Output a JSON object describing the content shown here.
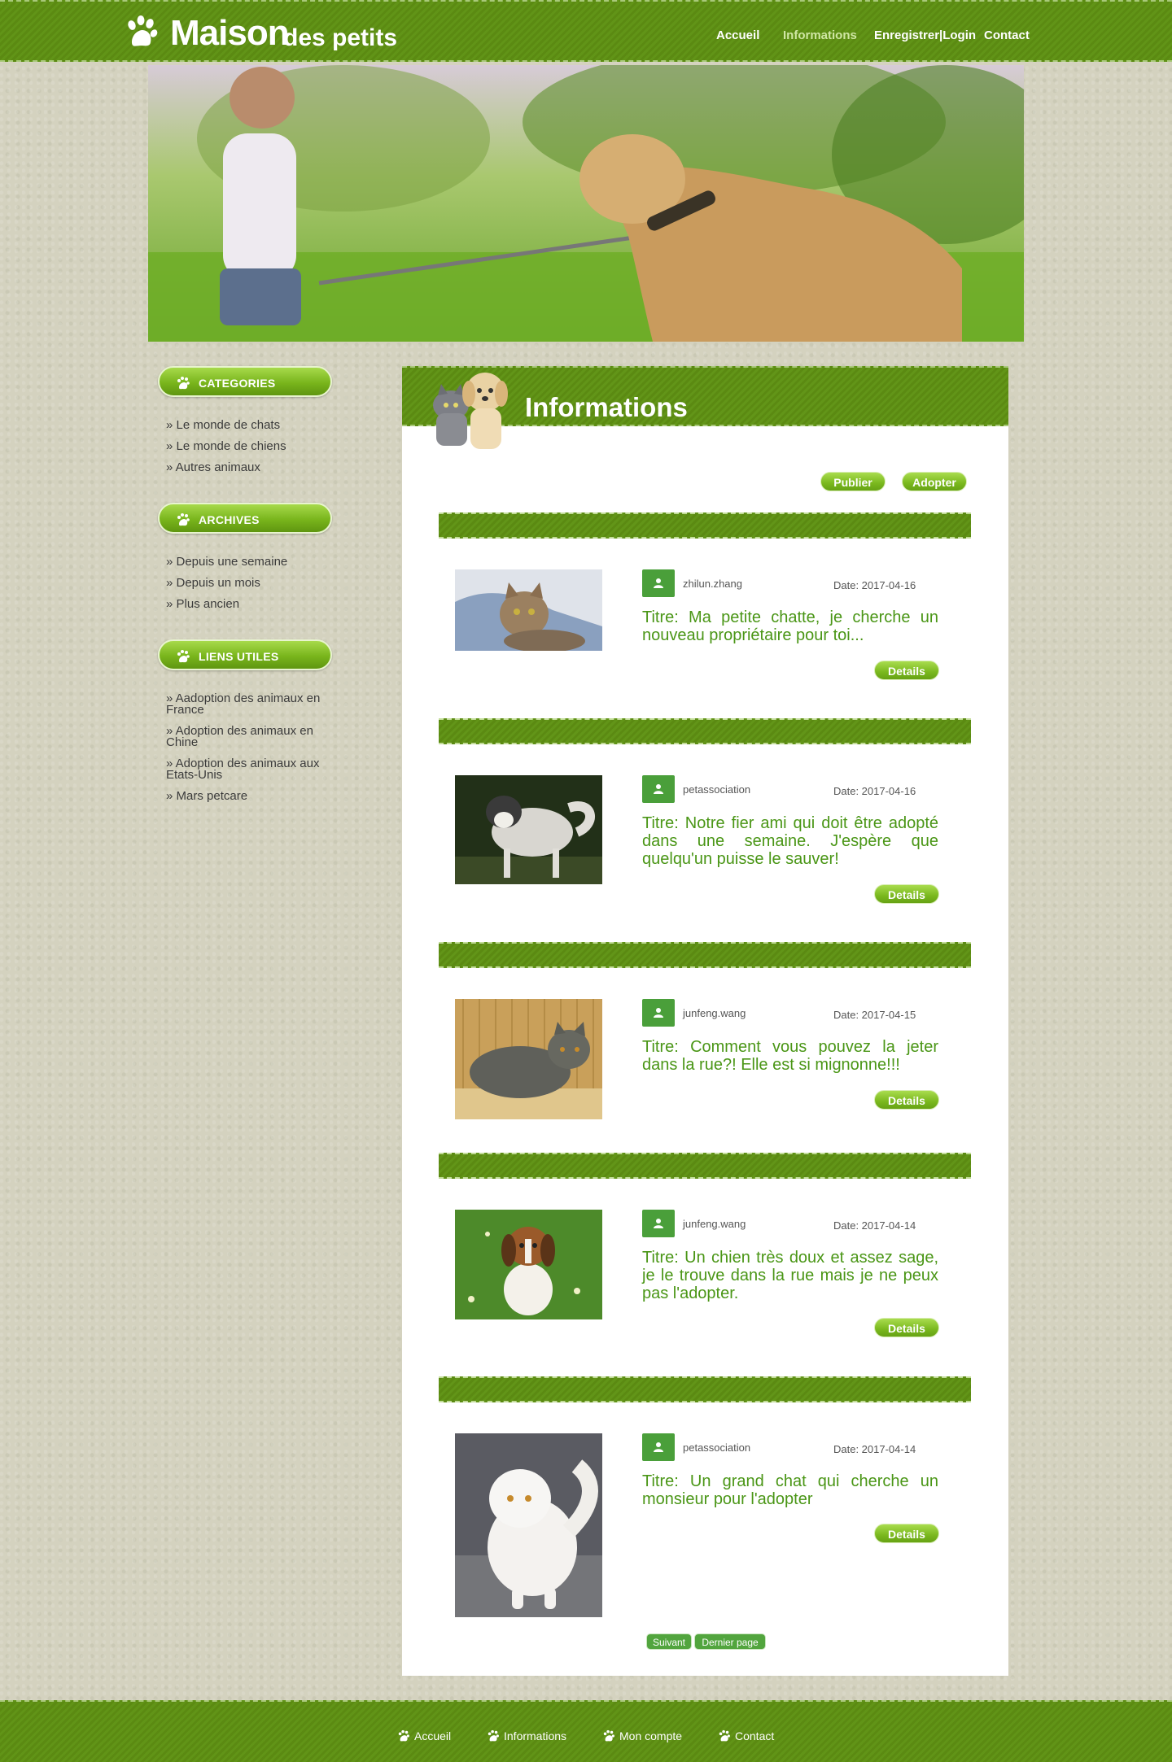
{
  "site": {
    "title_main": "Maison",
    "title_sub": "des petits"
  },
  "nav": {
    "items": [
      {
        "label": "Accueil"
      },
      {
        "label": "Informations"
      },
      {
        "label": "Enregistrer|Login"
      },
      {
        "label": "Contact"
      }
    ],
    "active": "Informations"
  },
  "sidebar": {
    "categories": {
      "heading": "CATEGORIES",
      "items": [
        "» Le monde de chats",
        "» Le monde de chiens",
        "» Autres animaux"
      ]
    },
    "archives": {
      "heading": "ARCHIVES",
      "items": [
        "» Depuis une semaine",
        "» Depuis un mois",
        "» Plus ancien"
      ]
    },
    "links": {
      "heading": "LIENS UTILES",
      "items": [
        "» Aadoption des animaux en France",
        "» Adoption des animaux en Chine",
        "» Adoption des animaux aux Etats-Unis",
        "» Mars petcare"
      ]
    }
  },
  "main": {
    "title": "Informations",
    "publish_label": "Publier",
    "adopt_label": "Adopter",
    "details_label": "Details",
    "posts": [
      {
        "user": "zhilun.zhang",
        "date": "Date: 2017-04-16",
        "title": "Titre: Ma petite chatte, je cherche un nouveau propriétaire pour toi...",
        "photo": "tabby-cat-photo"
      },
      {
        "user": "petassociation",
        "date": "Date: 2017-04-16",
        "title": "Titre: Notre fier ami qui doit être adopté dans une semaine. J'espère que quelqu'un puisse le sauver!",
        "photo": "husky-dog-photo"
      },
      {
        "user": "junfeng.wang",
        "date": "Date: 2017-04-15",
        "title": "Titre: Comment vous pouvez la jeter dans la rue?! Elle est si mignonne!!!",
        "photo": "grey-cat-photo"
      },
      {
        "user": "junfeng.wang",
        "date": "Date: 2017-04-14",
        "title": "Titre: Un chien très doux et assez sage, je le trouve dans la rue mais je ne peux pas l'adopter.",
        "photo": "beagle-puppy-photo"
      },
      {
        "user": "petassociation",
        "date": "Date: 2017-04-14",
        "title": "Titre: Un grand chat qui cherche un monsieur pour l'adopter",
        "photo": "white-persian-cat-photo"
      }
    ],
    "pagination": {
      "next_label": "Suivant",
      "last_label": "Dernier page"
    }
  },
  "footer": {
    "items": [
      "Accueil",
      "Informations",
      "Mon compte",
      "Contact"
    ]
  },
  "colors": {
    "brand_green": "#5b8a12",
    "title_green": "#4a9616",
    "button_green": "#7ab81e",
    "background": "#d4d2bf"
  }
}
